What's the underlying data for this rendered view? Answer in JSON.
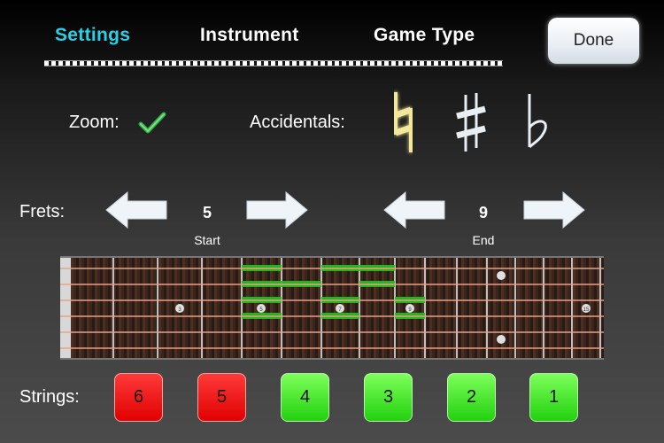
{
  "tabs": {
    "settings": "Settings",
    "instrument": "Instrument",
    "game_type": "Game Type"
  },
  "done_label": "Done",
  "zoom": {
    "label": "Zoom:",
    "checked": true
  },
  "accidentals": {
    "label": "Accidentals:",
    "items": [
      "natural-icon",
      "sharp-icon",
      "flat-icon"
    ],
    "selected": "natural"
  },
  "frets": {
    "label": "Frets:",
    "start": {
      "value": "5",
      "caption": "Start"
    },
    "end": {
      "value": "9",
      "caption": "End"
    }
  },
  "fretboard": {
    "fret_count": 14,
    "marker_numbers": [
      "3",
      "5",
      "7",
      "9",
      "15"
    ],
    "highlight_color": "#23c41d"
  },
  "strings": {
    "label": "Strings:",
    "buttons": [
      {
        "label": "6",
        "state": "off"
      },
      {
        "label": "5",
        "state": "off"
      },
      {
        "label": "4",
        "state": "on"
      },
      {
        "label": "3",
        "state": "on"
      },
      {
        "label": "2",
        "state": "on"
      },
      {
        "label": "1",
        "state": "on"
      }
    ]
  },
  "colors": {
    "active_tab": "#2ad0e6",
    "on": "#22d10f",
    "off": "#e00000"
  }
}
